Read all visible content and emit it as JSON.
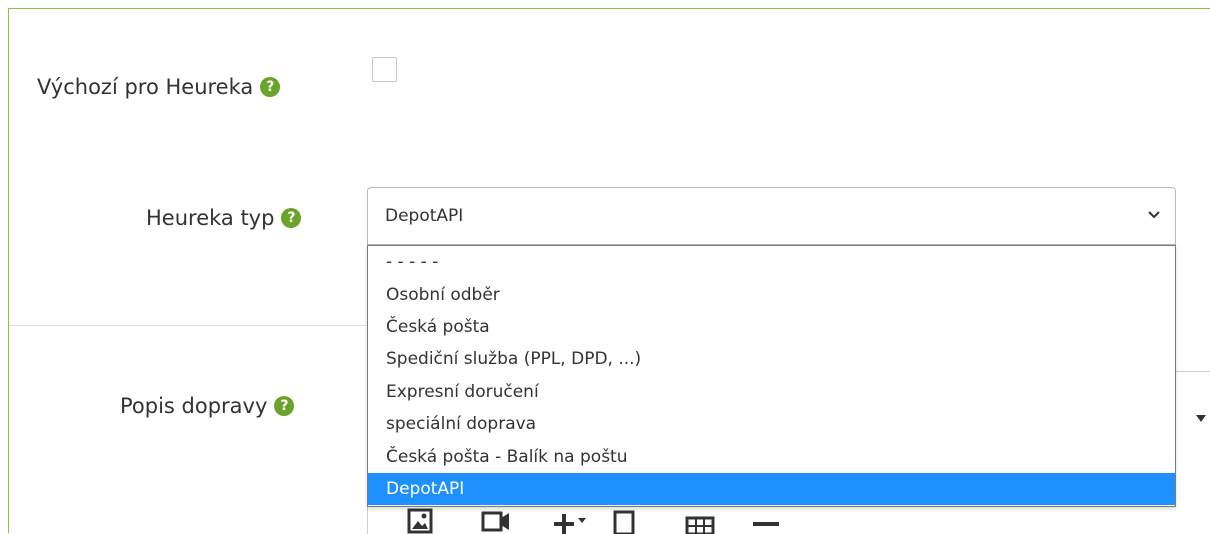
{
  "form": {
    "heureka_default": {
      "label": "Výchozí pro Heureka",
      "help_icon": "question-circle-icon",
      "checked": false
    },
    "heureka_type": {
      "label": "Heureka typ",
      "help_icon": "question-circle-icon",
      "selected_value": "DepotAPI",
      "options": [
        "- - - - -",
        "Osobní odběr",
        "Česká pošta",
        "Spediční služba (PPL, DPD, ...)",
        "Expresní doručení",
        "speciální doprava",
        "Česká pošta - Balík na poštu",
        "DepotAPI"
      ],
      "highlighted_option": "DepotAPI"
    },
    "description": {
      "label": "Popis dopravy",
      "help_icon": "question-circle-icon"
    }
  },
  "help_glyph": "?",
  "toolbar_icons": [
    "image-icon",
    "video-icon",
    "insert-plus-icon",
    "document-icon",
    "table-icon",
    "horizontal-line-icon"
  ],
  "colors": {
    "accent": "#8cc63f",
    "help_icon": "#6aa329",
    "selected_option": "#1e90ff"
  }
}
